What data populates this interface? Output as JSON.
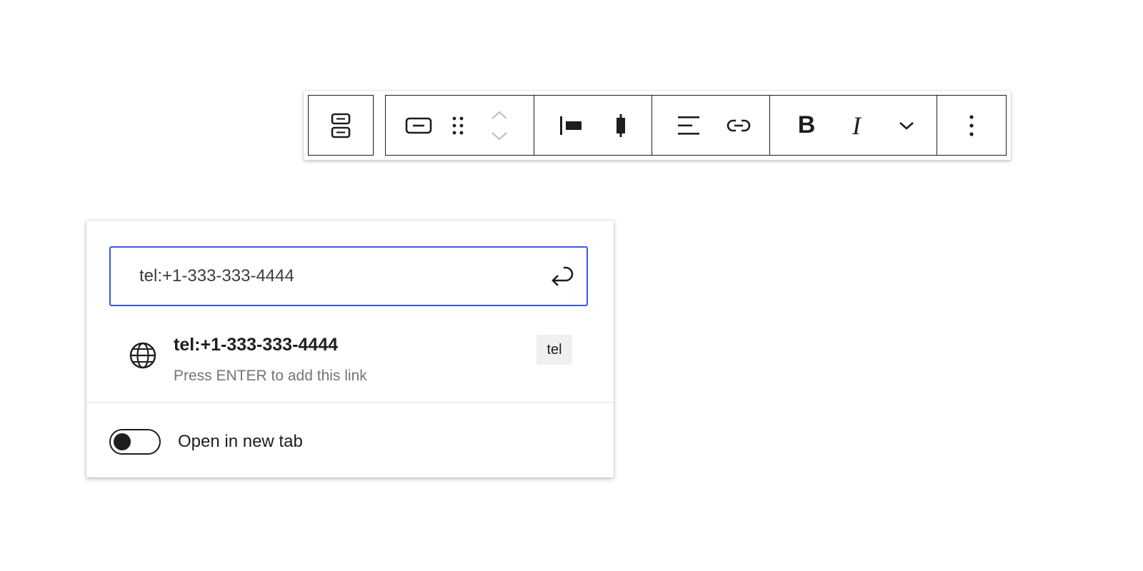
{
  "toolbar": {
    "parent_icon": "group-block-icon",
    "groups": [
      {
        "name": "block",
        "items": [
          "button-block-icon",
          "drag-handle-icon",
          "move-up-down-icon"
        ]
      },
      {
        "name": "justify",
        "items": [
          "justify-left-icon",
          "justify-center-icon"
        ]
      },
      {
        "name": "align-link",
        "items": [
          "align-text-left-icon",
          "link-icon"
        ]
      },
      {
        "name": "format",
        "items": [
          "bold-icon",
          "italic-icon",
          "chevron-down-icon"
        ]
      },
      {
        "name": "options",
        "items": [
          "more-vertical-icon"
        ]
      }
    ],
    "bold_label": "B",
    "italic_label": "I"
  },
  "link_popover": {
    "url_value": "tel:+1-333-333-4444",
    "submit_icon": "enter-return-icon",
    "suggestion": {
      "icon": "globe-icon",
      "title": "tel:+1-333-333-4444",
      "info": "Press ENTER to add this link",
      "badge": "tel"
    },
    "new_tab_toggle": {
      "label": "Open in new tab",
      "checked": false
    }
  },
  "colors": {
    "focus_blue": "#3858e9",
    "text": "#1e1e1e",
    "muted": "#757575",
    "badge_bg": "#f0f0f0"
  }
}
